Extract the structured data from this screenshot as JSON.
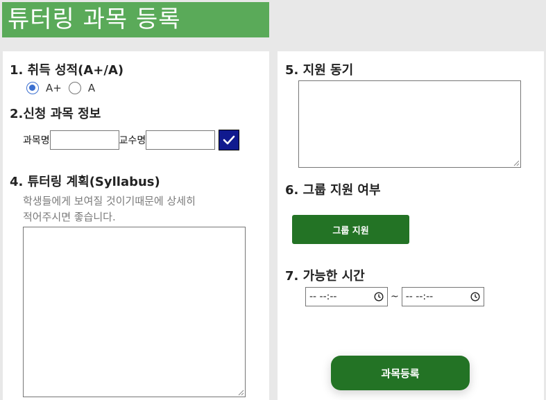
{
  "header": {
    "title": "튜터링 과목 등록"
  },
  "section1": {
    "title": "1. 취득 성적(A+/A)",
    "options": [
      {
        "label": "A+",
        "checked": true
      },
      {
        "label": "A",
        "checked": false
      }
    ]
  },
  "section2": {
    "title": "2.신청 과목 정보",
    "course_label": "과목명",
    "course_value": "",
    "professor_label": "교수명",
    "professor_value": "",
    "confirm_icon": "check-icon"
  },
  "section4": {
    "title": "4. 튜터링 계획(Syllabus)",
    "hint_line1": "학생들에게 보여질 것이기때문에 상세히",
    "hint_line2": "적어주시면 좋습니다.",
    "syllabus_value": ""
  },
  "section5": {
    "title": "5. 지원 동기",
    "motivation_value": ""
  },
  "section6": {
    "title": "6. 그룹 지원 여부",
    "button_label": "그룹 지원"
  },
  "section7": {
    "title": "7. 가능한 시간",
    "start_time": "-- --:--",
    "separator": "~",
    "end_time": "-- --:--"
  },
  "submit": {
    "label": "과목등록"
  },
  "colors": {
    "title_bar": "#5aaa59",
    "button_green": "#237325",
    "check_button": "#101a8f",
    "radio_accent": "#3b6fd0"
  }
}
